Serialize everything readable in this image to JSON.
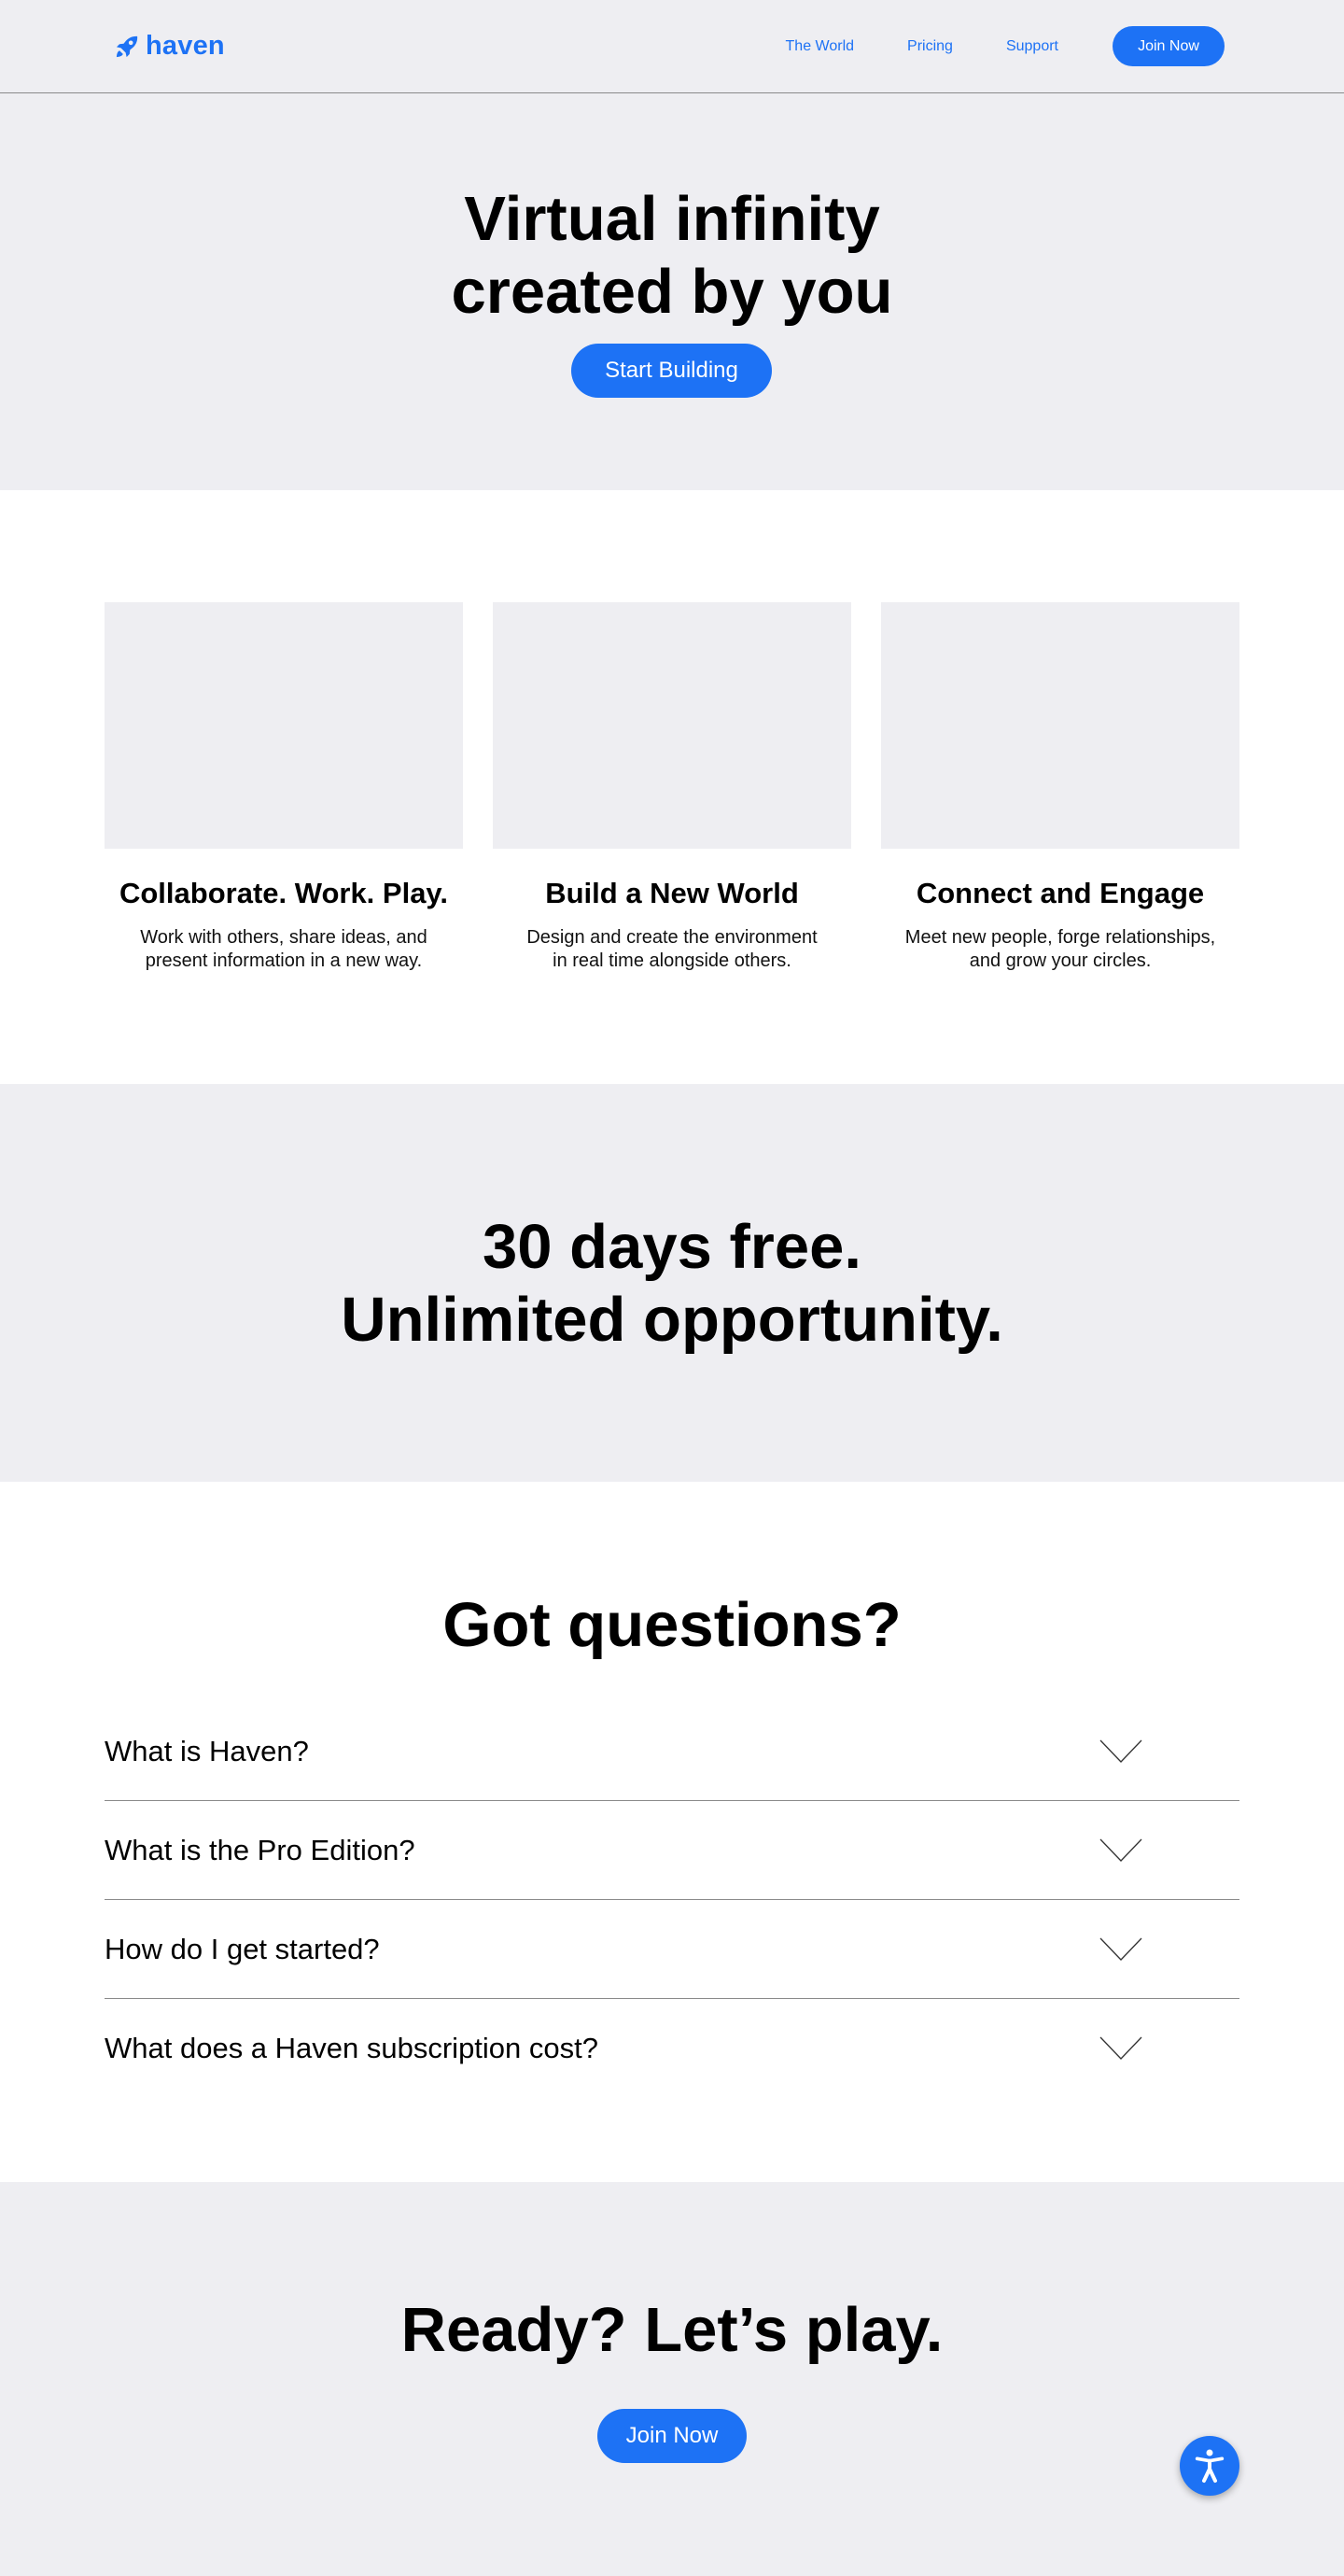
{
  "header": {
    "logo_text": "haven",
    "logo_icon": "rocket-icon",
    "nav": [
      {
        "label": "The World"
      },
      {
        "label": "Pricing"
      },
      {
        "label": "Support"
      }
    ],
    "join_label": "Join Now"
  },
  "hero": {
    "title_line1": "Virtual infinity",
    "title_line2": "created by you",
    "cta_label": "Start Building"
  },
  "features": [
    {
      "title": "Collaborate. Work. Play.",
      "desc_line1": "Work with others, share ideas, and",
      "desc_line2": "present information in a new way."
    },
    {
      "title": "Build a New World",
      "desc_line1": "Design and create the environment",
      "desc_line2": "in real time alongside others."
    },
    {
      "title": "Connect and Engage",
      "desc_line1": "Meet new people, forge relationships,",
      "desc_line2": "and grow your circles."
    }
  ],
  "promo": {
    "line1": "30 days free.",
    "line2": "Unlimited opportunity."
  },
  "faq": {
    "title": "Got questions?",
    "items": [
      {
        "question": "What is Haven?"
      },
      {
        "question": "What is the Pro Edition?"
      },
      {
        "question": "How do I get started?"
      },
      {
        "question": "What does a Haven subscription cost?"
      }
    ]
  },
  "cta": {
    "title": "Ready? Let’s play.",
    "button_label": "Join Now"
  },
  "accessibility_icon": "accessibility-icon",
  "colors": {
    "accent": "#1d72f5",
    "section_bg": "#eeeef2"
  }
}
